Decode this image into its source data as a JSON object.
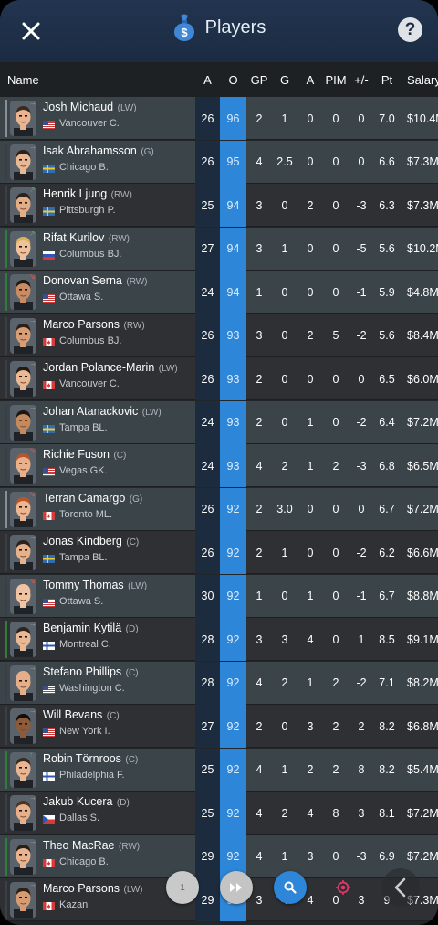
{
  "header": {
    "title": "Players",
    "close_label": "✕",
    "help_label": "?"
  },
  "columns": [
    "Name",
    "A",
    "O",
    "GP",
    "G",
    "A",
    "PIM",
    "+/-",
    "Pt",
    "Salary"
  ],
  "players": [
    {
      "name": "Josh Michaud",
      "pos": "(LW)",
      "team": "Vancouver C.",
      "flag": "us",
      "A": "26",
      "O": "96",
      "GP": "2",
      "G": "1",
      "A2": "0",
      "PIM": "0",
      "PM": "0",
      "Pt": "7.0",
      "Salary": "$10.4M",
      "accent": "#8a8f95",
      "arrow": "→",
      "arrowColor": "#9aa0a6",
      "skin": "#e9b48f",
      "hair": "#3a2a1d",
      "bg": "#3e4850"
    },
    {
      "name": "Isak Abrahamsson",
      "pos": "(G)",
      "team": "Chicago B.",
      "flag": "se",
      "A": "26",
      "O": "95",
      "GP": "4",
      "G": "2.5",
      "A2": "0",
      "PIM": "0",
      "PM": "0",
      "Pt": "6.6",
      "Salary": "$7.3M",
      "accent": "#3b4047",
      "arrow": "→",
      "arrowColor": "#9aa0a6",
      "skin": "#e8b793",
      "hair": "#2d2118",
      "bg": "#3e4850"
    },
    {
      "name": "Henrik Ljung",
      "pos": "(RW)",
      "team": "Pittsburgh P.",
      "flag": "se",
      "A": "25",
      "O": "94",
      "GP": "3",
      "G": "0",
      "A2": "2",
      "PIM": "0",
      "PM": "-3",
      "Pt": "6.3",
      "Salary": "$7.3M",
      "accent": "#3b4047",
      "arrow": "↗",
      "arrowColor": "#4caf50",
      "skin": "#e3ad86",
      "hair": "#2b2219",
      "bg": "#3e4850"
    },
    {
      "name": "Rifat Kurilov",
      "pos": "(RW)",
      "team": "Columbus BJ.",
      "flag": "ru",
      "A": "27",
      "O": "94",
      "GP": "3",
      "G": "1",
      "A2": "0",
      "PIM": "0",
      "PM": "-5",
      "Pt": "5.6",
      "Salary": "$10.2M",
      "accent": "#2f7d3a",
      "arrow": "↗",
      "arrowColor": "#4caf50",
      "skin": "#f0c29c",
      "hair": "#d8b35c",
      "bg": "#3e4850"
    },
    {
      "name": "Donovan Serna",
      "pos": "(RW)",
      "team": "Ottawa S.",
      "flag": "us",
      "A": "24",
      "O": "94",
      "GP": "1",
      "G": "0",
      "A2": "0",
      "PIM": "0",
      "PM": "-1",
      "Pt": "5.9",
      "Salary": "$4.8M",
      "accent": "#2f7d3a",
      "arrow": "↘",
      "arrowColor": "#e05545",
      "skin": "#c88c62",
      "hair": "#1f1711",
      "bg": "#3e4850"
    },
    {
      "name": "Marco Parsons",
      "pos": "(RW)",
      "team": "Columbus BJ.",
      "flag": "ca",
      "A": "26",
      "O": "93",
      "GP": "3",
      "G": "0",
      "A2": "2",
      "PIM": "5",
      "PM": "-2",
      "Pt": "5.6",
      "Salary": "$8.4M",
      "accent": "#3b4047",
      "arrow": "→",
      "arrowColor": "#9aa0a6",
      "skin": "#d79e76",
      "hair": "#2c1f16",
      "bg": "#3e4850"
    },
    {
      "name": "Jordan Polance-Marin",
      "pos": "(LW)",
      "team": "Vancouver C.",
      "flag": "ca",
      "A": "26",
      "O": "93",
      "GP": "2",
      "G": "0",
      "A2": "0",
      "PIM": "0",
      "PM": "0",
      "Pt": "6.5",
      "Salary": "$6.0M",
      "accent": "#3b4047",
      "arrow": "→",
      "arrowColor": "#9aa0a6",
      "skin": "#eab892",
      "hair": "#241a12",
      "bg": "#3e4850"
    },
    {
      "name": "Johan Atanackovic",
      "pos": "(LW)",
      "team": "Tampa BL.",
      "flag": "se",
      "A": "24",
      "O": "93",
      "GP": "2",
      "G": "0",
      "A2": "1",
      "PIM": "0",
      "PM": "-2",
      "Pt": "6.4",
      "Salary": "$7.2M",
      "accent": "#3b4047",
      "arrow": "→",
      "arrowColor": "#9aa0a6",
      "skin": "#c48a5e",
      "hair": "#1e1610",
      "bg": "#3e4850"
    },
    {
      "name": "Richie Fuson",
      "pos": "(C)",
      "team": "Vegas GK.",
      "flag": "us",
      "A": "24",
      "O": "93",
      "GP": "4",
      "G": "2",
      "A2": "1",
      "PIM": "2",
      "PM": "-3",
      "Pt": "6.8",
      "Salary": "$6.5M",
      "accent": "#3b4047",
      "arrow": "↘",
      "arrowColor": "#e05545",
      "skin": "#eab08c",
      "hair": "#b5562c",
      "bg": "#3e4850"
    },
    {
      "name": "Terran Camargo",
      "pos": "(G)",
      "team": "Toronto ML.",
      "flag": "ca",
      "A": "26",
      "O": "92",
      "GP": "2",
      "G": "3.0",
      "A2": "0",
      "PIM": "0",
      "PM": "0",
      "Pt": "6.7",
      "Salary": "$7.2M",
      "accent": "#8a8f95",
      "arrow": "↘",
      "arrowColor": "#e05545",
      "skin": "#ebb690",
      "hair": "#b8562b",
      "bg": "#3e4850"
    },
    {
      "name": "Jonas Kindberg",
      "pos": "(C)",
      "team": "Tampa BL.",
      "flag": "se",
      "A": "26",
      "O": "92",
      "GP": "2",
      "G": "1",
      "A2": "0",
      "PIM": "0",
      "PM": "-2",
      "Pt": "6.2",
      "Salary": "$6.6M",
      "accent": "#3b4047",
      "arrow": "→",
      "arrowColor": "#9aa0a6",
      "skin": "#e6b28c",
      "hair": "#2e231a",
      "bg": "#3e4850"
    },
    {
      "name": "Tommy Thomas",
      "pos": "(LW)",
      "team": "Ottawa S.",
      "flag": "us",
      "A": "30",
      "O": "92",
      "GP": "1",
      "G": "0",
      "A2": "1",
      "PIM": "0",
      "PM": "-1",
      "Pt": "6.7",
      "Salary": "$8.8M",
      "accent": "#3b4047",
      "arrow": "↘",
      "arrowColor": "#e05545",
      "skin": "#f0c4a2",
      "hair": "#f0c4a2",
      "bg": "#3e4850"
    },
    {
      "name": "Benjamin Kytilä",
      "pos": "(D)",
      "team": "Montreal C.",
      "flag": "fi",
      "A": "28",
      "O": "92",
      "GP": "3",
      "G": "3",
      "A2": "4",
      "PIM": "0",
      "PM": "1",
      "Pt": "8.5",
      "Salary": "$9.1M",
      "accent": "#2f7d3a",
      "arrow": "→",
      "arrowColor": "#9aa0a6",
      "skin": "#e9b994",
      "hair": "#2f241b",
      "bg": "#3e4850"
    },
    {
      "name": "Stefano Phillips",
      "pos": "(C)",
      "team": "Washington C.",
      "flag": "us",
      "A": "28",
      "O": "92",
      "GP": "4",
      "G": "2",
      "A2": "1",
      "PIM": "2",
      "PM": "-2",
      "Pt": "7.1",
      "Salary": "$8.2M",
      "accent": "#3b4047",
      "arrow": "→",
      "arrowColor": "#9aa0a6",
      "skin": "#e4ae88",
      "hair": "#e4ae88",
      "bg": "#3e4850"
    },
    {
      "name": "Will Bevans",
      "pos": "(C)",
      "team": "New York I.",
      "flag": "us",
      "A": "27",
      "O": "92",
      "GP": "2",
      "G": "0",
      "A2": "3",
      "PIM": "2",
      "PM": "2",
      "Pt": "8.2",
      "Salary": "$6.8M",
      "accent": "#3b4047",
      "arrow": "→",
      "arrowColor": "#9aa0a6",
      "skin": "#8d5a3a",
      "hair": "#120d09",
      "bg": "#3e4850"
    },
    {
      "name": "Robin Törnroos",
      "pos": "(C)",
      "team": "Philadelphia F.",
      "flag": "fi",
      "A": "25",
      "O": "92",
      "GP": "4",
      "G": "1",
      "A2": "2",
      "PIM": "2",
      "PM": "8",
      "Pt": "8.2",
      "Salary": "$5.4M",
      "accent": "#2f7d3a",
      "arrow": "↑",
      "arrowColor": "#4caf50",
      "skin": "#e9b691",
      "hair": "#3a2a1d",
      "bg": "#3e4850"
    },
    {
      "name": "Jakub Kucera",
      "pos": "(D)",
      "team": "Dallas S.",
      "flag": "cz",
      "A": "25",
      "O": "92",
      "GP": "4",
      "G": "2",
      "A2": "4",
      "PIM": "8",
      "PM": "3",
      "Pt": "8.1",
      "Salary": "$7.2M",
      "accent": "#3b4047",
      "arrow": "→",
      "arrowColor": "#9aa0a6",
      "skin": "#e6b08a",
      "hair": "#4a3525",
      "bg": "#3e4850"
    },
    {
      "name": "Theo MacRae",
      "pos": "(RW)",
      "team": "Chicago B.",
      "flag": "ca",
      "A": "29",
      "O": "92",
      "GP": "4",
      "G": "1",
      "A2": "3",
      "PIM": "0",
      "PM": "-3",
      "Pt": "6.9",
      "Salary": "$7.2M",
      "accent": "#2f7d3a",
      "arrow": "→",
      "arrowColor": "#9aa0a6",
      "skin": "#e8b38e",
      "hair": "#2a1f16",
      "bg": "#3e4850"
    },
    {
      "name": "Marco Parsons",
      "pos": "(LW)",
      "team": "Kazan",
      "flag": "ca",
      "A": "29",
      "O": "92",
      "GP": "3",
      "G": "4",
      "A2": "4",
      "PIM": "0",
      "PM": "3",
      "Pt": "9",
      "Salary": "$7.3M",
      "accent": "#3b4047",
      "arrow": "→",
      "arrowColor": "#9aa0a6",
      "skin": "#d59c74",
      "hair": "#2c1f16",
      "bg": "#3e4850"
    }
  ],
  "bottom_bar": {
    "page_label": "1",
    "fast_forward_icon": "fast-forward-icon",
    "search_icon": "search-icon",
    "target_icon": "target-icon",
    "back_icon": "back-icon"
  },
  "colors": {
    "accent_blue": "#2d86d8",
    "topbar": "#1b2b42",
    "highlight_row": "#3a4449",
    "row": "#2e3033"
  }
}
